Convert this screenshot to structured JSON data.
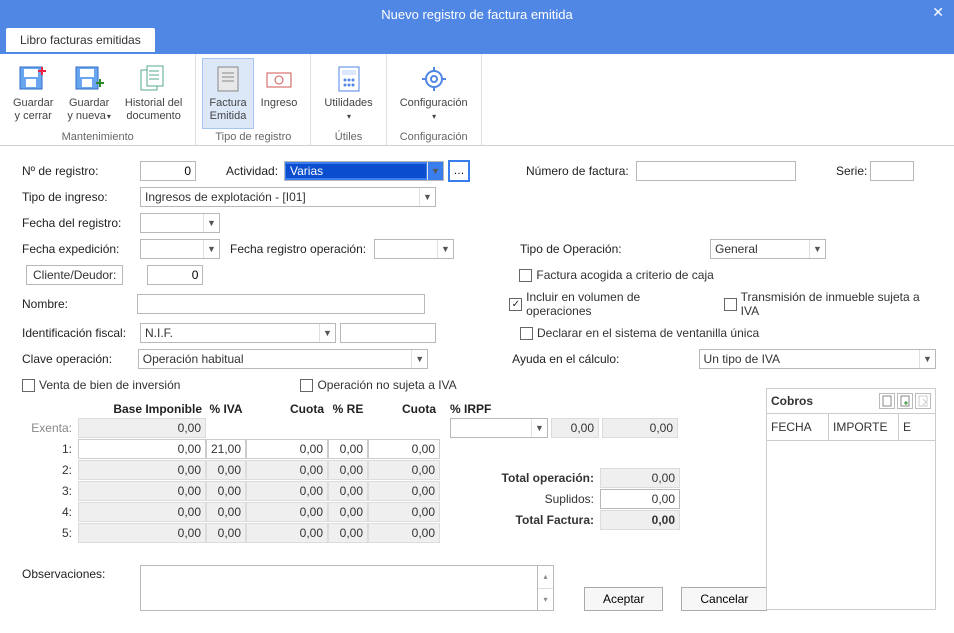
{
  "window": {
    "title": "Nuevo registro de factura emitida",
    "close_glyph": "✕"
  },
  "tab": {
    "label": "Libro facturas emitidas"
  },
  "ribbon": {
    "groups": [
      {
        "title": "Mantenimiento",
        "buttons": [
          {
            "id": "guardar-cerrar",
            "label": "Guardar\ny cerrar",
            "has_dropdown": false
          },
          {
            "id": "guardar-nueva",
            "label": "Guardar\ny nueva",
            "has_dropdown": true
          },
          {
            "id": "historial",
            "label": "Historial del\ndocumento",
            "has_dropdown": false
          }
        ]
      },
      {
        "title": "Tipo de registro",
        "buttons": [
          {
            "id": "factura-emitida",
            "label": "Factura\nEmitida",
            "active": true
          },
          {
            "id": "ingreso",
            "label": "Ingreso"
          }
        ]
      },
      {
        "title": "Útiles",
        "buttons": [
          {
            "id": "utilidades",
            "label": "Utilidades",
            "has_dropdown": true
          }
        ]
      },
      {
        "title": "Configuración",
        "buttons": [
          {
            "id": "configuracion",
            "label": "Configuración",
            "has_dropdown": true
          }
        ]
      }
    ]
  },
  "form": {
    "n_registro_label": "Nº de registro:",
    "n_registro_value": "0",
    "actividad_label": "Actividad:",
    "actividad_value": "Varias",
    "numero_factura_label": "Número de factura:",
    "numero_factura_value": "",
    "serie_label": "Serie:",
    "serie_value": "",
    "tipo_ingreso_label": "Tipo de ingreso:",
    "tipo_ingreso_value": "Ingresos de explotación - [I01]",
    "fecha_registro_label": "Fecha del registro:",
    "fecha_registro_value": "",
    "fecha_exped_label": "Fecha expedición:",
    "fecha_exped_value": "",
    "fecha_reg_op_label": "Fecha registro operación:",
    "fecha_reg_op_value": "",
    "tipo_operacion_label": "Tipo de Operación:",
    "tipo_operacion_value": "General",
    "cliente_btn": "Cliente/Deudor:",
    "cliente_value": "0",
    "nombre_label": "Nombre:",
    "nombre_value": "",
    "idfiscal_label": "Identificación fiscal:",
    "idfiscal_value": "N.I.F.",
    "idfiscal_num": "",
    "clave_op_label": "Clave operación:",
    "clave_op_value": "Operación habitual",
    "chk_factura_caja": "Factura acogida a criterio de caja",
    "chk_factura_caja_checked": false,
    "chk_volumen": "Incluir en  volumen de operaciones",
    "chk_volumen_checked": true,
    "chk_transmision": "Transmisión de inmueble sujeta a IVA",
    "chk_transmision_checked": false,
    "chk_ventanilla": "Declarar en el sistema de ventanilla única",
    "chk_ventanilla_checked": false,
    "ayuda_calc_label": "Ayuda en el cálculo:",
    "ayuda_calc_value": "Un tipo de IVA",
    "chk_venta_inversion": "Venta de bien de inversión",
    "chk_venta_inversion_checked": false,
    "chk_op_no_sujeta": "Operación no sujeta a IVA",
    "chk_op_no_sujeta_checked": false
  },
  "tax": {
    "headers": {
      "base": "Base Imponible",
      "iva": "% IVA",
      "cuota": "Cuota",
      "re": "% RE",
      "cuota2": "Cuota",
      "irpf": "% IRPF"
    },
    "exenta_label": "Exenta:",
    "exenta_base": "0,00",
    "irpf_combo": "",
    "irpf_val": "0,00",
    "irpf_cuota": "0,00",
    "rows": [
      {
        "n": "1:",
        "base": "0,00",
        "iva": "21,00",
        "cuota": "0,00",
        "re": "0,00",
        "cuota2": "0,00"
      },
      {
        "n": "2:",
        "base": "0,00",
        "iva": "0,00",
        "cuota": "0,00",
        "re": "0,00",
        "cuota2": "0,00"
      },
      {
        "n": "3:",
        "base": "0,00",
        "iva": "0,00",
        "cuota": "0,00",
        "re": "0,00",
        "cuota2": "0,00"
      },
      {
        "n": "4:",
        "base": "0,00",
        "iva": "0,00",
        "cuota": "0,00",
        "re": "0,00",
        "cuota2": "0,00"
      },
      {
        "n": "5:",
        "base": "0,00",
        "iva": "0,00",
        "cuota": "0,00",
        "re": "0,00",
        "cuota2": "0,00"
      }
    ],
    "totals": {
      "total_op_label": "Total operación:",
      "total_op": "0,00",
      "suplidos_label": "Suplidos:",
      "suplidos": "0,00",
      "total_fact_label": "Total Factura:",
      "total_fact": "0,00"
    }
  },
  "cobros": {
    "title": "Cobros",
    "col_fecha": "FECHA",
    "col_importe": "IMPORTE",
    "col_e": "E"
  },
  "obs_label": "Observaciones:",
  "obs_value": "",
  "buttons": {
    "aceptar": "Aceptar",
    "cancelar": "Cancelar"
  }
}
